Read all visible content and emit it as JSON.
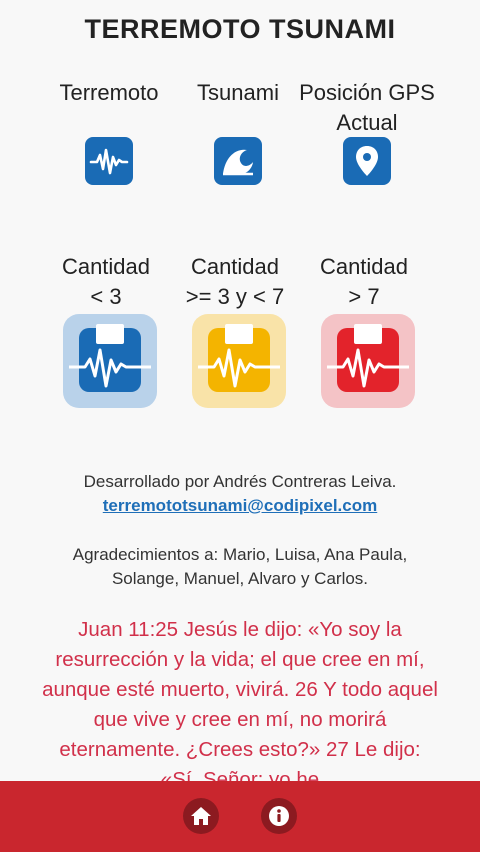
{
  "header": {
    "title": "TERREMOTO TSUNAMI"
  },
  "legend": [
    {
      "label": "Terremoto",
      "icon": "earthquake-waveform-icon"
    },
    {
      "label": "Tsunami",
      "icon": "wave-icon"
    },
    {
      "label": "Posición GPS Actual",
      "icon": "map-pin-icon"
    }
  ],
  "magnitudes": [
    {
      "line1": "Cantidad",
      "line2": "< 3",
      "color": "#1a6bb5",
      "bg": "#b9d2ea"
    },
    {
      "line1": "Cantidad",
      "line2": ">= 3 y < 7",
      "color": "#f4b400",
      "bg": "#f9e3a8"
    },
    {
      "line1": "Cantidad",
      "line2": "> 7",
      "color": "#e3232b",
      "bg": "#f4c3c6"
    }
  ],
  "credits": {
    "developer": "Desarrollado por Andrés Contreras Leiva.",
    "email": "terremototsunami@codipixel.com",
    "thanks": "Agradecimientos a: Mario, Luisa, Ana Paula, Solange, Manuel, Alvaro y Carlos."
  },
  "verse": "Juan 11:25 Jesús le dijo: «Yo soy la resurrección y la vida; el que cree en mí, aunque esté muerto, vivirá. 26 Y todo aquel que vive y cree en mí, no morirá eternamente. ¿Crees esto?» 27 Le dijo: «Sí, Señor; yo he",
  "nav": {
    "home_icon": "home-icon",
    "info_icon": "info-icon"
  }
}
